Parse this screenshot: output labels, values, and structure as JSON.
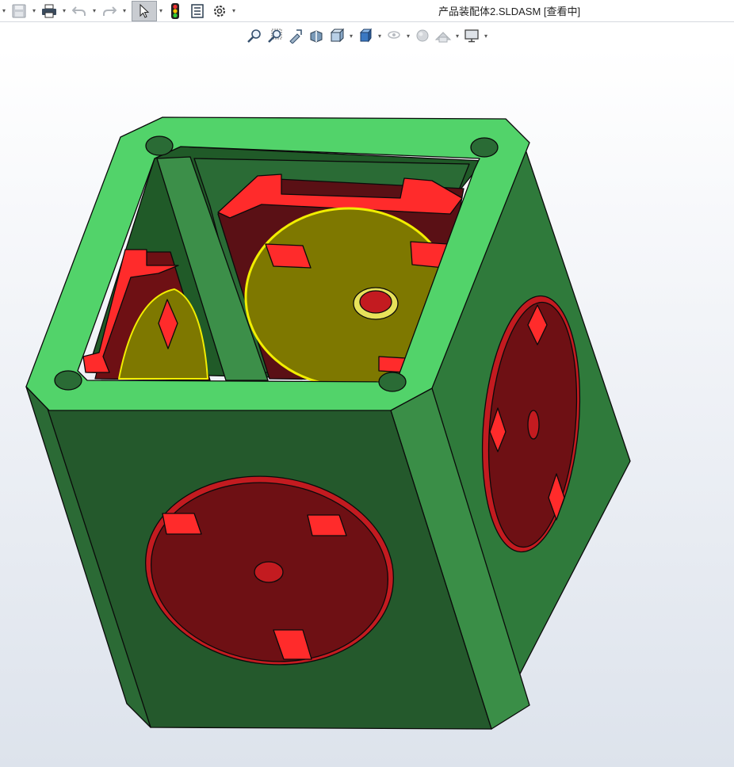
{
  "window": {
    "title": "产品装配体2.SLDASM [查看中]"
  },
  "toolbar": {
    "items": [
      {
        "name": "save",
        "icon": "save-icon"
      },
      {
        "name": "print",
        "icon": "print-icon"
      },
      {
        "name": "undo",
        "icon": "undo-icon"
      },
      {
        "name": "redo",
        "icon": "redo-icon"
      },
      {
        "name": "select",
        "icon": "pointer-icon"
      },
      {
        "name": "rebuild",
        "icon": "traffic-light-icon"
      },
      {
        "name": "file-properties",
        "icon": "file-properties-icon"
      },
      {
        "name": "options",
        "icon": "gear-icon"
      }
    ]
  },
  "view_toolbar": {
    "items": [
      {
        "name": "zoom-to-fit",
        "icon": "zoom-fit-icon"
      },
      {
        "name": "zoom-to-area",
        "icon": "zoom-area-icon"
      },
      {
        "name": "previous-view",
        "icon": "previous-view-icon"
      },
      {
        "name": "section-view",
        "icon": "section-view-icon"
      },
      {
        "name": "view-orientation",
        "icon": "view-orientation-icon"
      },
      {
        "name": "display-style",
        "icon": "display-style-icon"
      },
      {
        "name": "hide-show-items",
        "icon": "hide-show-icon"
      },
      {
        "name": "edit-appearance",
        "icon": "appearance-icon"
      },
      {
        "name": "apply-scene",
        "icon": "scene-icon"
      },
      {
        "name": "view-settings",
        "icon": "monitor-icon"
      }
    ]
  },
  "colors": {
    "frame_light": "#52d36a",
    "frame_dark": "#2a6b35",
    "side_face": "#2f7a3b",
    "front_face": "#24592c",
    "socket_red": "#7d1518",
    "socket_rim": "#c31b20",
    "pin_red": "#ff2b2b",
    "yellow_part": "#7e7800",
    "yellow_edge": "#f2ee00"
  }
}
